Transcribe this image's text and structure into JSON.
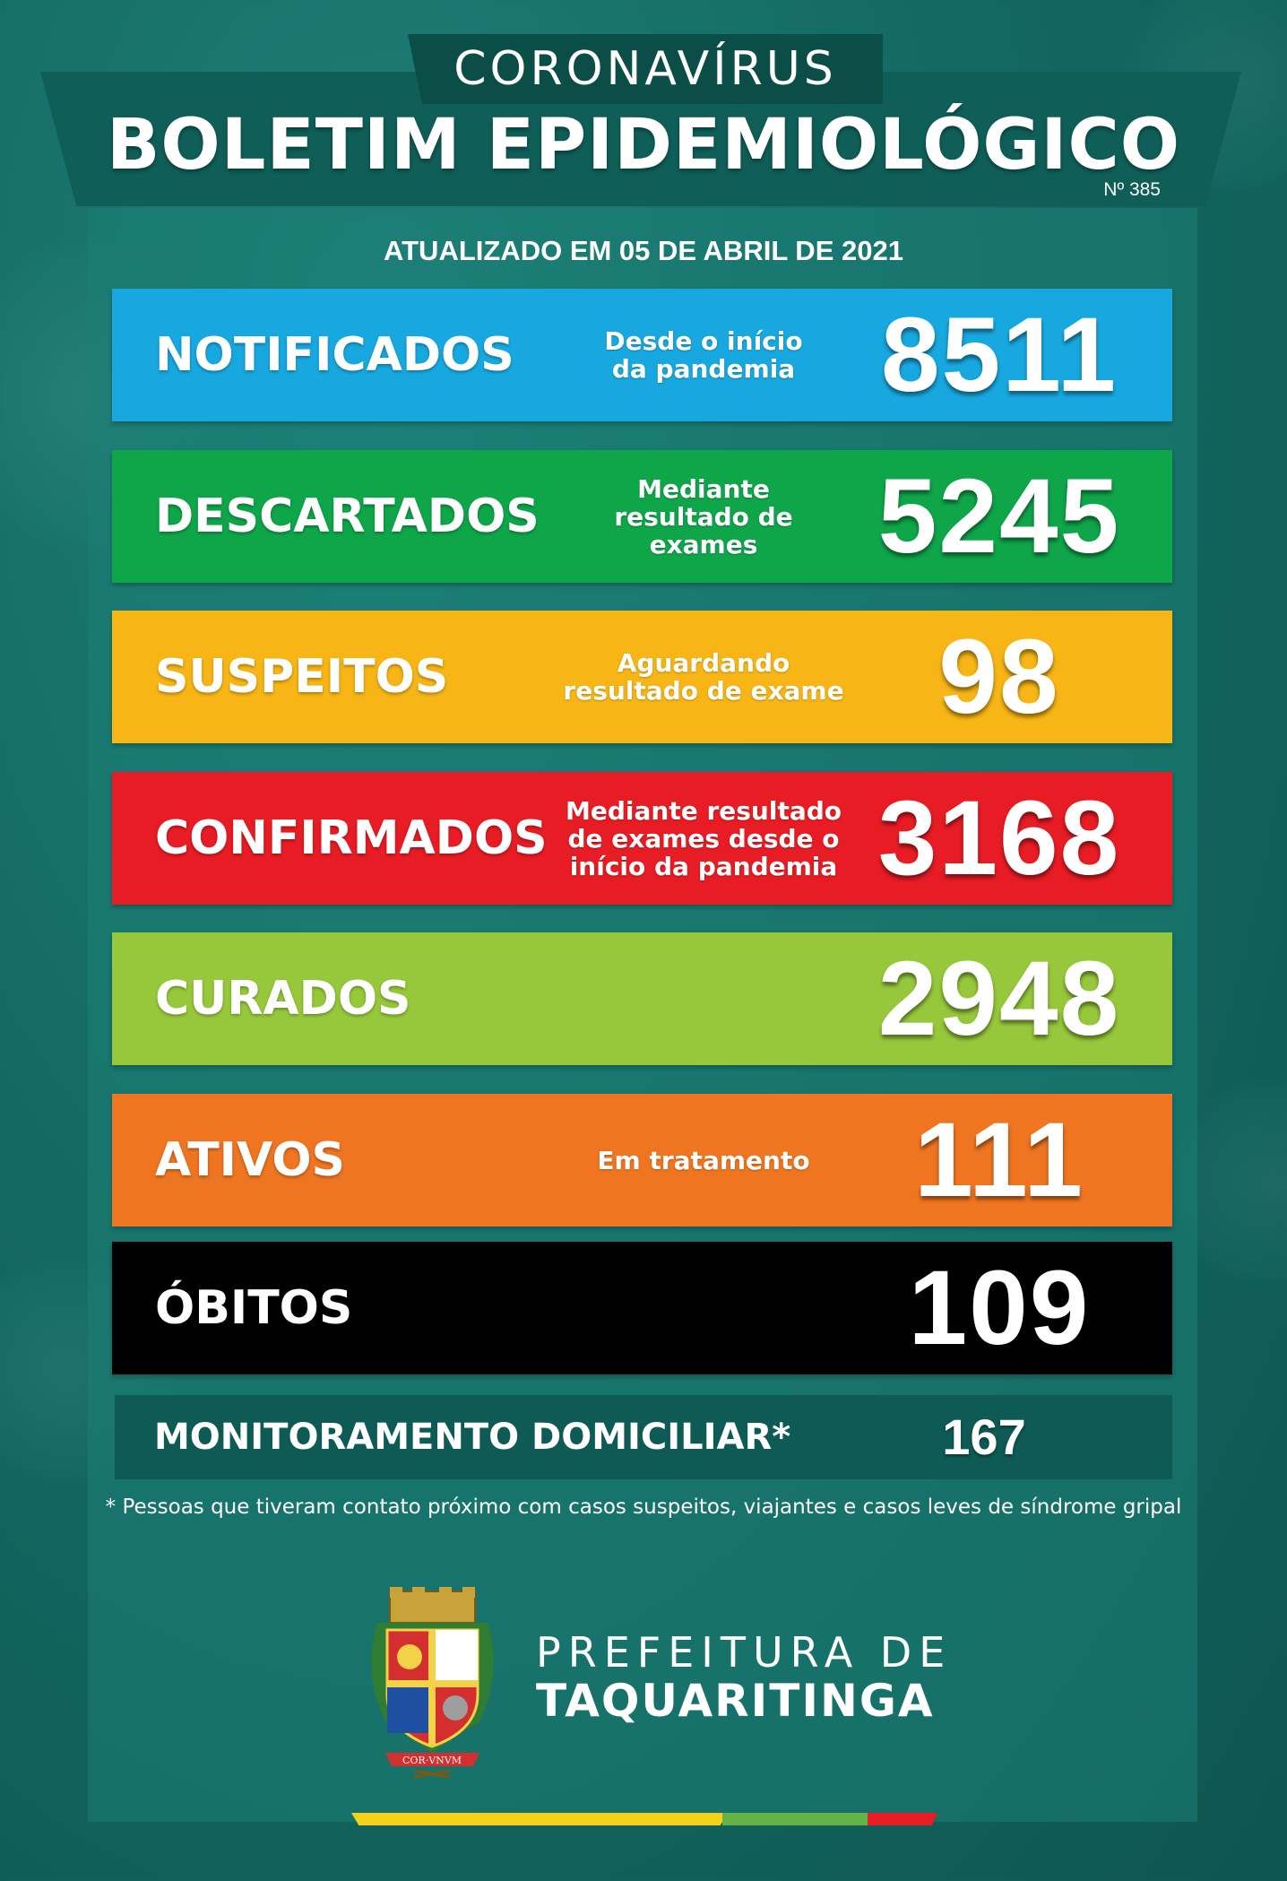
{
  "header": {
    "supertitle": "CORONAVÍRUS",
    "title": "BOLETIM EPIDEMIOLÓGICO",
    "bulletin_number": "Nº 385",
    "updated": "ATUALIZADO EM 05 DE ABRIL DE 2021"
  },
  "cards": {
    "notificados": {
      "label": "NOTIFICADOS",
      "sub": "Desde o início da pandemia",
      "value": "8511",
      "color": "#18a8e0"
    },
    "descartados": {
      "label": "DESCARTADOS",
      "sub": "Mediante resultado de exames",
      "value": "5245",
      "color": "#0fa64a"
    },
    "suspeitos": {
      "label": "SUSPEITOS",
      "sub": "Aguardando resultado de exame",
      "value": "98",
      "color": "#f7b516"
    },
    "confirmados": {
      "label": "CONFIRMADOS",
      "sub": "Mediante resultado de exames desde o início da pandemia",
      "value": "3168",
      "color": "#e81c24"
    },
    "curados": {
      "label": "CURADOS",
      "value": "2948",
      "color": "#97c83b"
    },
    "ativos": {
      "label": "ATIVOS",
      "sub": "Em tratamento",
      "value": "111",
      "color": "#ef7521"
    },
    "obitos": {
      "label": "ÓBITOS",
      "value": "109",
      "color": "#000000"
    }
  },
  "monitoramento": {
    "label": "MONITORAMENTO DOMICILIAR*",
    "value": "167"
  },
  "footnote": "* Pessoas que tiveram contato próximo com casos suspeitos, viajantes e casos leves de síndrome gripal",
  "footer": {
    "prefeitura_line1": "PREFEITURA DE",
    "prefeitura_line2": "TAQUARITINGA",
    "crest_motto": "COR·VNVM"
  },
  "colors": {
    "background": "#146a63",
    "stripe_yellow": "#f2d21b",
    "stripe_green": "#64b346",
    "stripe_red": "#e81c24"
  }
}
